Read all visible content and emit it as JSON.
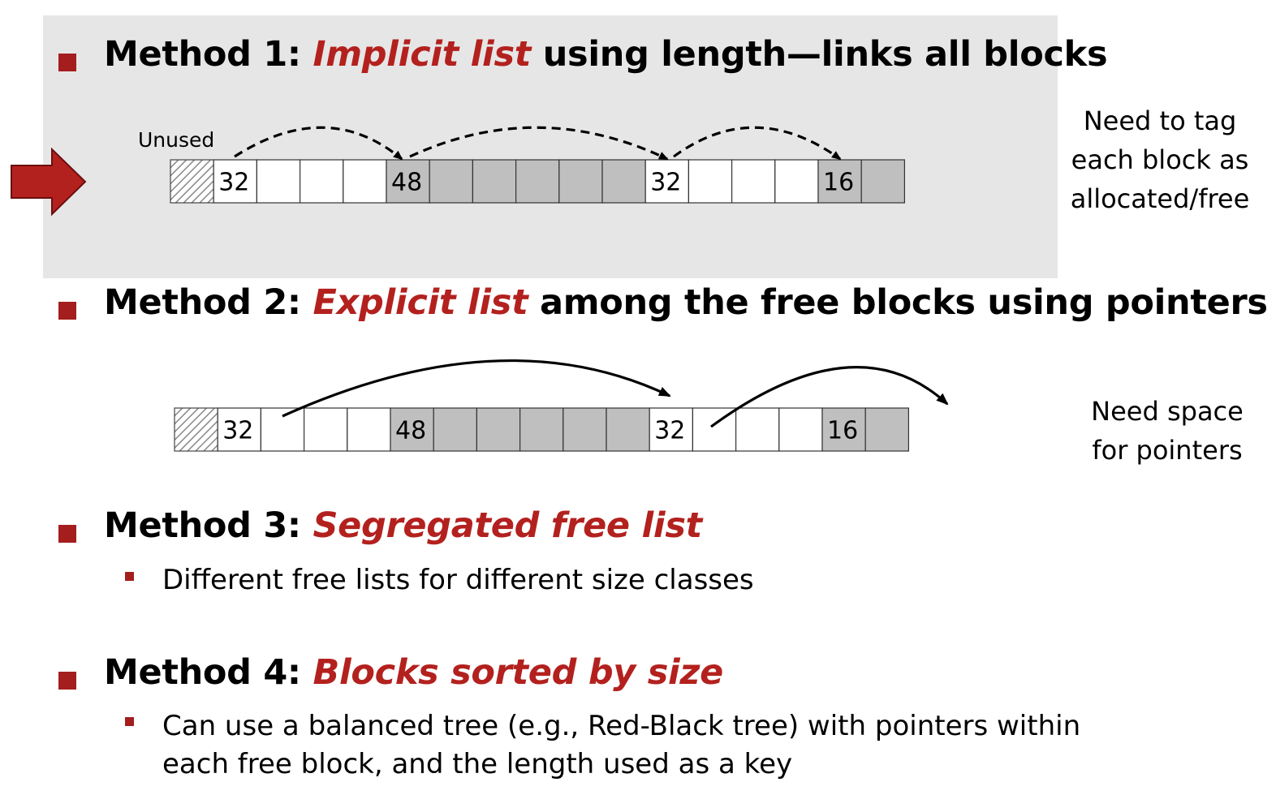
{
  "method1": {
    "prefix": "Method 1: ",
    "emphasis": "Implicit list",
    "suffix": " using length—links all blocks",
    "unused_label": "Unused",
    "note_lines": [
      "Need to tag",
      "each block as",
      "allocated/free"
    ]
  },
  "method2": {
    "prefix": "Method 2: ",
    "emphasis": "Explicit list",
    "suffix": " among the free blocks using pointers",
    "note_lines": [
      "Need space",
      "for pointers"
    ]
  },
  "method3": {
    "prefix": "Method 3: ",
    "emphasis": "Segregated free list",
    "sub": "Different free lists for different size classes"
  },
  "method4": {
    "prefix": "Method 4: ",
    "emphasis": "Blocks sorted by size",
    "sub_lines": [
      "Can use a balanced tree (e.g., Red-Black tree) with pointers within",
      "each free block, and the length used as a key"
    ]
  },
  "heap1": {
    "cells": [
      {
        "label": "32",
        "state": "free"
      },
      {
        "label": "",
        "state": "free"
      },
      {
        "label": "",
        "state": "free"
      },
      {
        "label": "",
        "state": "free"
      },
      {
        "label": "48",
        "state": "allocated"
      },
      {
        "label": "",
        "state": "allocated"
      },
      {
        "label": "",
        "state": "allocated"
      },
      {
        "label": "",
        "state": "allocated"
      },
      {
        "label": "",
        "state": "allocated"
      },
      {
        "label": "",
        "state": "allocated"
      },
      {
        "label": "32",
        "state": "free"
      },
      {
        "label": "",
        "state": "free"
      },
      {
        "label": "",
        "state": "free"
      },
      {
        "label": "",
        "state": "free"
      },
      {
        "label": "16",
        "state": "allocated"
      },
      {
        "label": "",
        "state": "allocated"
      }
    ]
  },
  "heap2": {
    "cells": [
      {
        "label": "32",
        "state": "free"
      },
      {
        "label": "",
        "state": "free"
      },
      {
        "label": "",
        "state": "free"
      },
      {
        "label": "",
        "state": "free"
      },
      {
        "label": "48",
        "state": "allocated"
      },
      {
        "label": "",
        "state": "allocated"
      },
      {
        "label": "",
        "state": "allocated"
      },
      {
        "label": "",
        "state": "allocated"
      },
      {
        "label": "",
        "state": "allocated"
      },
      {
        "label": "",
        "state": "allocated"
      },
      {
        "label": "32",
        "state": "free"
      },
      {
        "label": "",
        "state": "free"
      },
      {
        "label": "",
        "state": "free"
      },
      {
        "label": "",
        "state": "free"
      },
      {
        "label": "16",
        "state": "allocated"
      },
      {
        "label": "",
        "state": "allocated"
      }
    ]
  },
  "colors": {
    "accent": "#b3211e",
    "bullet": "#a41e1e",
    "highlight_bg": "#e6e6e6",
    "allocated_fill": "#bfbfbf",
    "free_fill": "#ffffff"
  }
}
